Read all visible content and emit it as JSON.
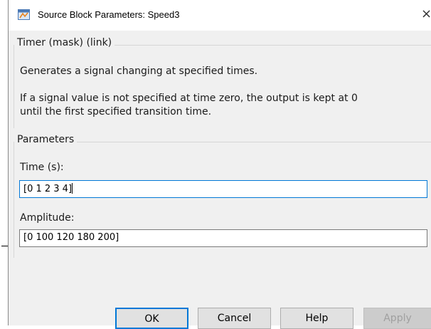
{
  "window": {
    "title": "Source Block Parameters: Speed3",
    "close_glyph": "×"
  },
  "description_group": {
    "legend": "Timer (mask) (link)",
    "line1": "Generates a signal changing at specified times.",
    "line2": "If a signal value is not specified at time zero, the output is kept at 0",
    "line3": "until the first specified transition time."
  },
  "parameters_group": {
    "legend": "Parameters",
    "time_label": "Time (s):",
    "time_value": "[0 1 2 3 4]",
    "amplitude_label": "Amplitude:",
    "amplitude_value": "[0 100 120 180 200]"
  },
  "buttons": {
    "ok": "OK",
    "cancel": "Cancel",
    "help": "Help",
    "apply": "Apply"
  },
  "colors": {
    "accent": "#0078d7",
    "dialog_bg": "#f0f0f0"
  },
  "icons": {
    "title": "simulink-block-icon",
    "close": "close-icon"
  }
}
